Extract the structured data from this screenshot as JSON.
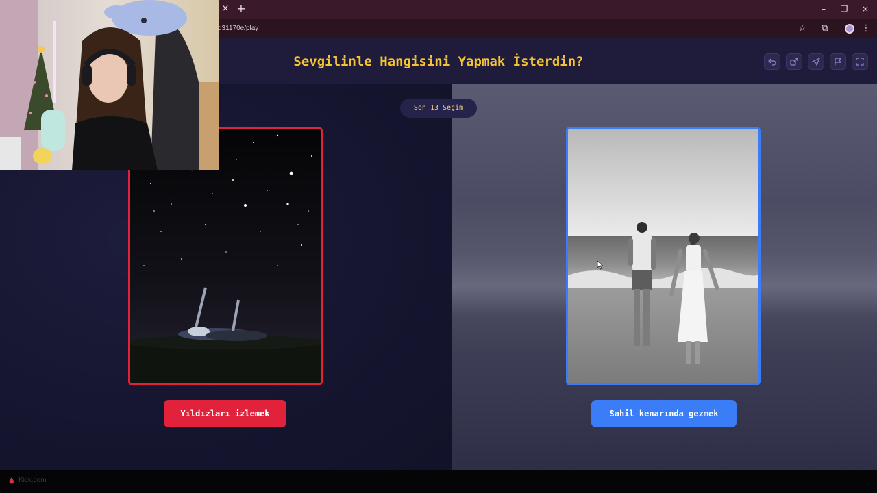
{
  "browser": {
    "url": "d31170e/play",
    "close_tab_glyph": "×",
    "new_tab_glyph": "+",
    "minimize_glyph": "–",
    "restore_glyph": "❐",
    "close_window_glyph": "×",
    "bookmark_glyph": "☆",
    "extensions_glyph": "⧉",
    "menu_glyph": "⋮"
  },
  "header": {
    "title": "Sevgilinle Hangisini Yapmak İsterdin?",
    "buttons": [
      "undo-icon",
      "share-icon",
      "send-icon",
      "flag-icon",
      "fullscreen-icon"
    ]
  },
  "counter": {
    "label": "Son 13 Seçim"
  },
  "options": [
    {
      "label": "Yıldızları izlemek",
      "image": "couple-stargazing-photo",
      "accent": "#e2223b"
    },
    {
      "label": "Sahil kenarında gezmek",
      "image": "couple-beach-walk-photo",
      "accent": "#3b7df6"
    }
  ],
  "colors": {
    "title": "#f6c431",
    "header_bg": "#1e1b3b",
    "main_bg": "#171733",
    "left_accent": "#e2223b",
    "right_accent": "#3b7df6"
  },
  "footer": {
    "watermark": "Kick.com"
  }
}
